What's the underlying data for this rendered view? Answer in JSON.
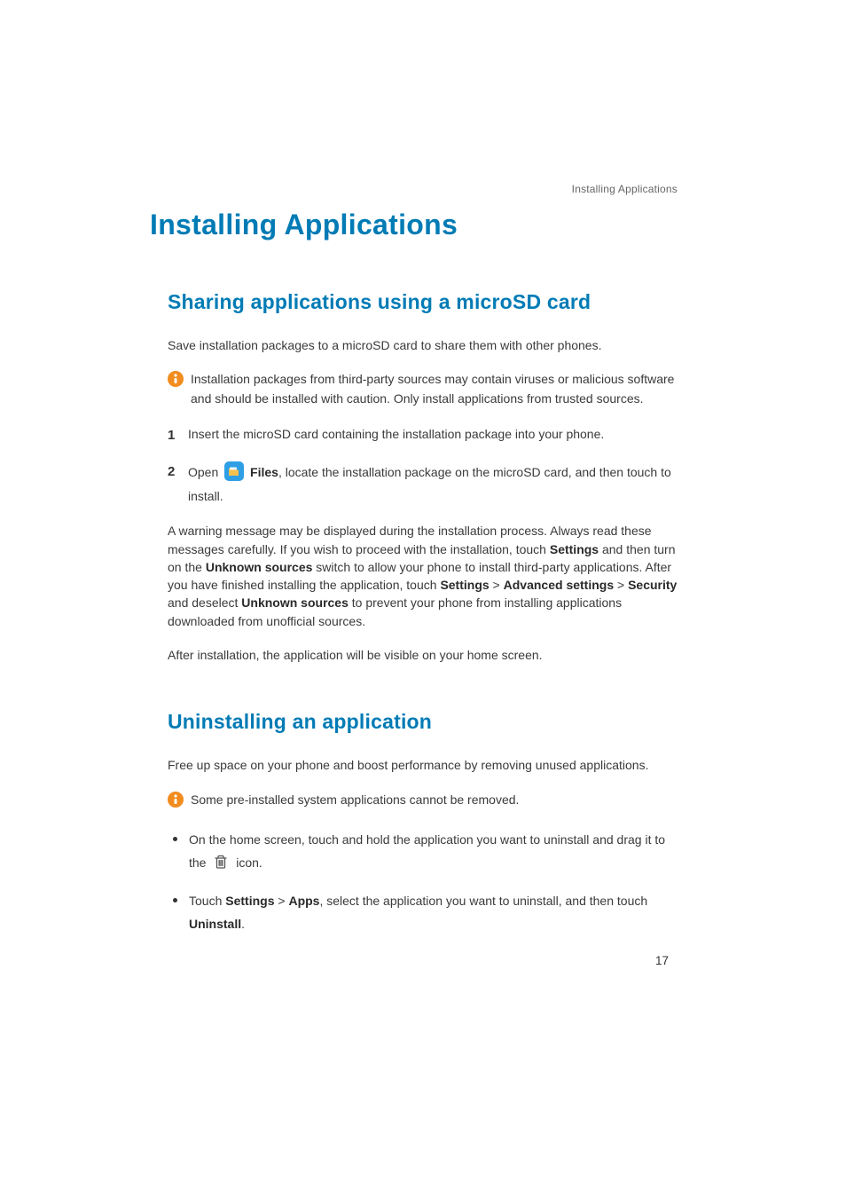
{
  "header": {
    "running_title": "Installing Applications"
  },
  "title": "Installing Applications",
  "page_number": "17",
  "sections": [
    {
      "heading": "Sharing applications using a microSD card",
      "intro": "Save installation packages to a microSD card to share them with other phones.",
      "info": "Installation packages from third-party sources may contain viruses or malicious software and should be installed with caution. Only install applications from trusted sources.",
      "step1_num": "1",
      "step1": "Insert the microSD card containing the installation package into your phone.",
      "step2_num": "2",
      "step2_pre": "Open ",
      "step2_files": "Files",
      "step2_post": ", locate the installation package on the microSD card, and then touch to install.",
      "warn_p1_a": "A warning message may be displayed during the installation process. Always read these messages carefully. If you wish to proceed with the installation, touch ",
      "warn_p1_settings": "Settings",
      "warn_p1_b": " and then turn on the ",
      "warn_p1_unknown": "Unknown sources",
      "warn_p1_c": " switch to allow your phone to install third-party applications. After you have finished installing the application, touch ",
      "warn_p1_settings2": "Settings",
      "warn_p1_gt": " > ",
      "warn_p1_adv": "Advanced settings",
      "warn_p1_gt2": " > ",
      "warn_p1_sec": "Security",
      "warn_p1_d": " and deselect ",
      "warn_p1_unknown2": "Unknown sources",
      "warn_p1_e": " to prevent your phone from installing applications downloaded from unofficial sources.",
      "after": "After installation, the application will be visible on your home screen."
    },
    {
      "heading": "Uninstalling an application",
      "intro": "Free up space on your phone and boost performance by removing unused applications.",
      "info": "Some pre-installed system applications cannot be removed.",
      "b1_a": "On the home screen, touch and hold the application you want to uninstall and drag it to the ",
      "b1_b": " icon.",
      "b2_a": "Touch ",
      "b2_settings": "Settings",
      "b2_gt": " > ",
      "b2_apps": "Apps",
      "b2_b": ", select the application you want to uninstall, and then touch ",
      "b2_uninstall": "Uninstall",
      "b2_c": "."
    }
  ]
}
